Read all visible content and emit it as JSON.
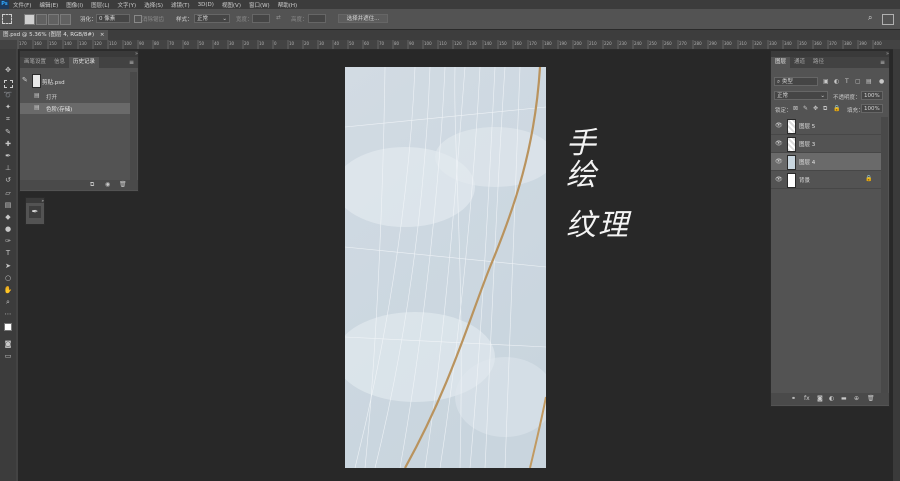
{
  "menubar": {
    "logo": "Ps",
    "items": [
      "文件(F)",
      "编辑(E)",
      "图像(I)",
      "图层(L)",
      "文字(Y)",
      "选择(S)",
      "滤镜(T)",
      "3D(D)",
      "视图(V)",
      "窗口(W)",
      "帮助(H)"
    ]
  },
  "options": {
    "feather_label": "羽化：",
    "feather_value": "0 像素",
    "antialias_label": "消除锯齿",
    "style_label": "样式：",
    "style_value": "正常",
    "width_label": "宽度：",
    "height_label": "高度：",
    "select_mask_button": "选择并遮住..."
  },
  "document": {
    "tab_title": "图.psd @ 5.36% (图层 4, RGB/8#)",
    "tab_close": "×"
  },
  "ruler": {
    "marks": [
      "170",
      "160",
      "150",
      "140",
      "130",
      "120",
      "110",
      "100",
      "90",
      "80",
      "70",
      "60",
      "50",
      "40",
      "30",
      "20",
      "10",
      "0",
      "10",
      "20",
      "30",
      "40",
      "50",
      "60",
      "70",
      "80",
      "90",
      "100",
      "110",
      "120",
      "130",
      "140",
      "150",
      "160",
      "170",
      "180",
      "190",
      "200",
      "210",
      "220",
      "230",
      "240",
      "250",
      "260",
      "270",
      "280",
      "290",
      "300",
      "310",
      "320",
      "330",
      "340",
      "350",
      "360",
      "370",
      "380",
      "390",
      "400"
    ]
  },
  "history_panel": {
    "tabs": [
      "画笔设置",
      "信息",
      "历史记录"
    ],
    "snapshot_name": "剪贴.psd",
    "steps": [
      "打开",
      "色阶(存储)"
    ]
  },
  "canvas_text": {
    "line1": "手",
    "line2": "绘",
    "line3": "纹理"
  },
  "layers_panel": {
    "tabs": [
      "图层",
      "通道",
      "路径"
    ],
    "filter_label": "类型",
    "blend_mode": "正常",
    "opacity_label": "不透明度：",
    "opacity_value": "100%",
    "lock_label": "锁定：",
    "fill_label": "填充：",
    "fill_value": "100%",
    "layers": [
      {
        "name": "图层 5"
      },
      {
        "name": "图层 3"
      },
      {
        "name": "图层 4"
      },
      {
        "name": "背景"
      }
    ]
  }
}
